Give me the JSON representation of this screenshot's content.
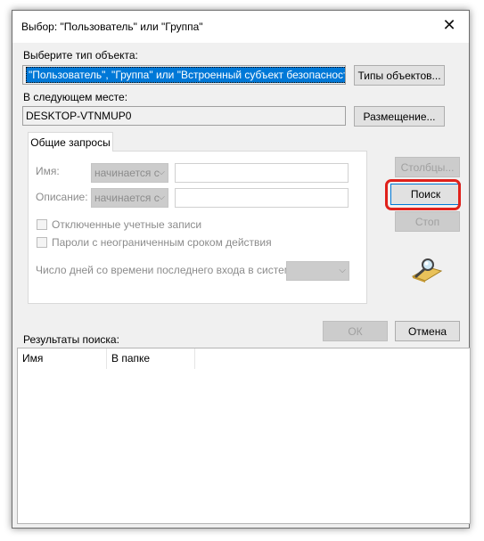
{
  "window": {
    "title": "Выбор: \"Пользователь\" или \"Группа\"",
    "close_glyph": "✕"
  },
  "object_type": {
    "label": "Выберите тип объекта:",
    "value": "\"Пользователь\", \"Группа\" или \"Встроенный субъект безопасности\"",
    "button": "Типы объектов..."
  },
  "location": {
    "label": "В следующем месте:",
    "value": "DESKTOP-VTNMUP0",
    "button": "Размещение..."
  },
  "tab": {
    "label": "Общие запросы",
    "name_label": "Имя:",
    "name_mode": "начинается с",
    "description_label": "Описание:",
    "description_mode": "начинается с",
    "disabled_accounts": "Отключенные учетные записи",
    "no_expire_passwords": "Пароли с неограниченным сроком действия",
    "days_since_login_label": "Число дней со времени последнего входа в систему:"
  },
  "side_buttons": {
    "columns": "Столбцы...",
    "search": "Поиск",
    "stop": "Стоп"
  },
  "footer": {
    "ok": "ОК",
    "cancel": "Отмена"
  },
  "results": {
    "label": "Результаты поиска:",
    "columns": [
      "Имя",
      "В папке"
    ]
  },
  "icons": {
    "search_icon": "magnifier-icon",
    "chevron": "chevron-down-icon"
  },
  "colors": {
    "selection": "#0078d7",
    "highlight_ring": "#e0211b"
  }
}
